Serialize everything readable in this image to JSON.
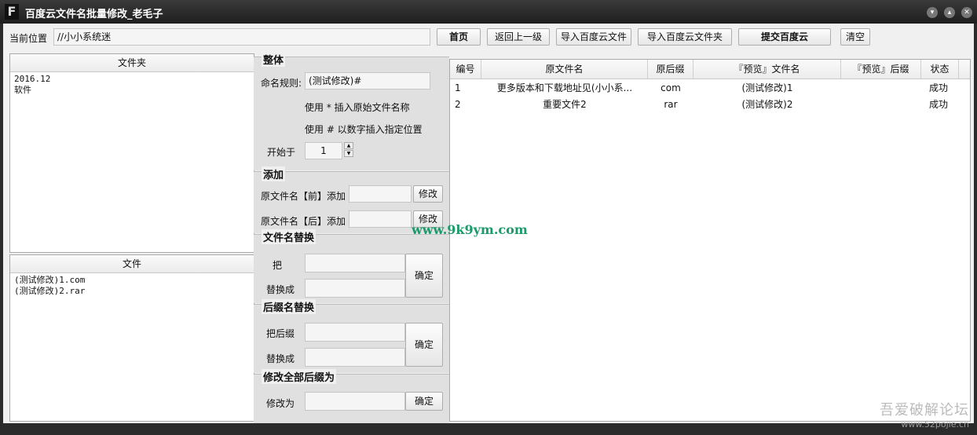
{
  "window": {
    "title": "百度云文件名批量修改_老毛子",
    "app_icon": "F"
  },
  "toolbar": {
    "location_label": "当前位置",
    "location_value": "//小小系统迷",
    "home": "首页",
    "back": "返回上一级",
    "import_file": "导入百度云文件",
    "import_folder": "导入百度云文件夹",
    "submit": "提交百度云",
    "clear": "清空"
  },
  "folders": {
    "header": "文件夹",
    "items": [
      "2016.12",
      "软件"
    ]
  },
  "files": {
    "header": "文件",
    "items": [
      "(测试修改)1.com",
      "(测试修改)2.rar"
    ]
  },
  "overall": {
    "title": "整体",
    "rule_label": "命名规则:",
    "rule_value": "(测试修改)#",
    "hint1": "使用 * 插入原始文件名称",
    "hint2": "使用 # 以数字插入指定位置",
    "start_label": "开始于",
    "start_value": "1"
  },
  "add": {
    "title": "添加",
    "before_label": "原文件名【前】添加",
    "after_label": "原文件名【后】添加",
    "modify": "修改"
  },
  "replace": {
    "title": "文件名替换",
    "from_label": "把",
    "to_label": "替换成",
    "confirm": "确定"
  },
  "ext_replace": {
    "title": "后缀名替换",
    "from_label": "把后缀",
    "to_label": "替换成",
    "confirm": "确定"
  },
  "ext_all": {
    "title": "修改全部后缀为",
    "label": "修改为",
    "confirm": "确定"
  },
  "table": {
    "columns": [
      "编号",
      "原文件名",
      "原后缀",
      "『预览』文件名",
      "『预览』后缀",
      "状态"
    ],
    "rows": [
      [
        "1",
        "更多版本和下载地址见(小小系...",
        "com",
        "(测试修改)1",
        "",
        "成功"
      ],
      [
        "2",
        "重要文件2",
        "rar",
        "(测试修改)2",
        "",
        "成功"
      ]
    ]
  },
  "watermark": "www.9k9ym.com",
  "corner_logo": {
    "line1": "吾爱破解论坛",
    "line2": "www.52pojie.cn"
  }
}
